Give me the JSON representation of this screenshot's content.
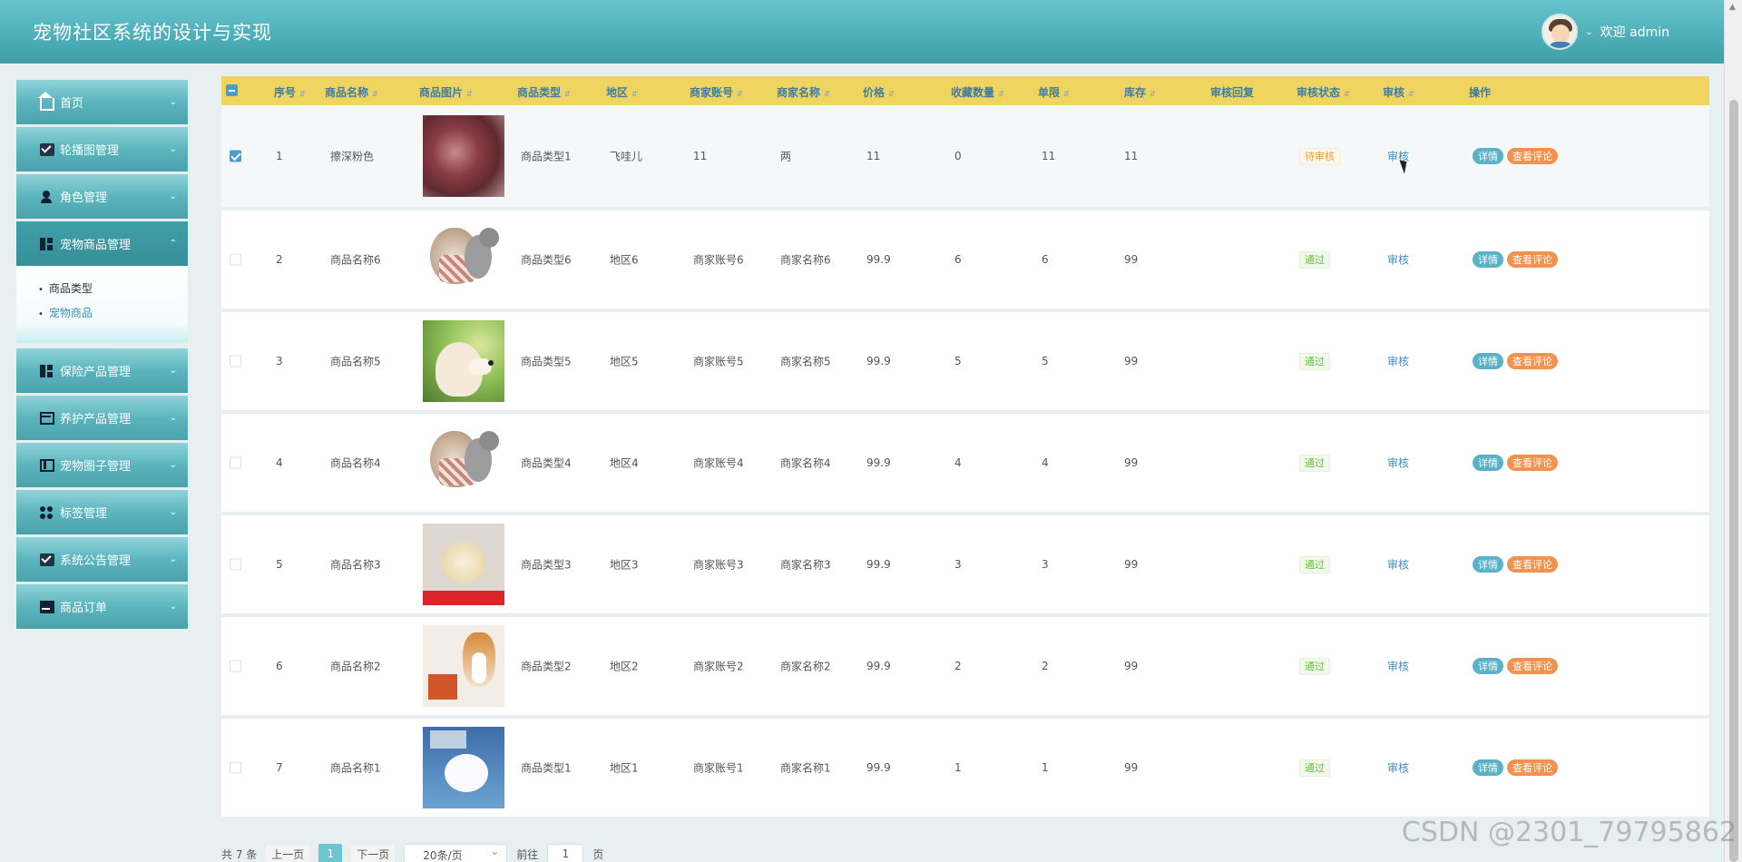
{
  "header": {
    "title": "宠物社区系统的设计与实现",
    "welcome": "欢迎 admin"
  },
  "sidebar": {
    "items": [
      {
        "label": "首页",
        "icon": "home-icon"
      },
      {
        "label": "轮播图管理",
        "icon": "mail-icon"
      },
      {
        "label": "角色管理",
        "icon": "user-icon"
      },
      {
        "label": "宠物商品管理",
        "icon": "grid-icon",
        "open": true,
        "children": [
          {
            "label": "商品类型"
          },
          {
            "label": "宠物商品",
            "active": true
          }
        ]
      },
      {
        "label": "保险产品管理",
        "icon": "grid-icon"
      },
      {
        "label": "养护产品管理",
        "icon": "layout-icon"
      },
      {
        "label": "宠物圈子管理",
        "icon": "panel-icon"
      },
      {
        "label": "标签管理",
        "icon": "dots-icon"
      },
      {
        "label": "系统公告管理",
        "icon": "mail-icon"
      },
      {
        "label": "商品订单",
        "icon": "card-icon"
      }
    ]
  },
  "table": {
    "columns": [
      "序号",
      "商品名称",
      "商品图片",
      "商品类型",
      "地区",
      "商家账号",
      "商家名称",
      "价格",
      "收藏数量",
      "单限",
      "库存",
      "审核回复",
      "审核状态",
      "审核",
      "操作"
    ],
    "audit_label": "审核",
    "detail_label": "详情",
    "review_label": "查看评论",
    "rows": [
      {
        "no": "1",
        "name": "擦深粉色",
        "type": "商品类型1",
        "region": "飞哇儿",
        "account": "11",
        "merchant": "两",
        "price": "11",
        "fav": "0",
        "limit": "11",
        "stock": "11",
        "reply": "",
        "status": "待审核",
        "checked": true,
        "img": "meat"
      },
      {
        "no": "2",
        "name": "商品名称6",
        "type": "商品类型6",
        "region": "地区6",
        "account": "商家账号6",
        "merchant": "商家名称6",
        "price": "99.9",
        "fav": "6",
        "limit": "6",
        "stock": "99",
        "reply": "",
        "status": "通过",
        "checked": false,
        "img": "hedgehog"
      },
      {
        "no": "3",
        "name": "商品名称5",
        "type": "商品类型5",
        "region": "地区5",
        "account": "商家账号5",
        "merchant": "商家名称5",
        "price": "99.9",
        "fav": "5",
        "limit": "5",
        "stock": "99",
        "reply": "",
        "status": "通过",
        "checked": false,
        "img": "dog"
      },
      {
        "no": "4",
        "name": "商品名称4",
        "type": "商品类型4",
        "region": "地区4",
        "account": "商家账号4",
        "merchant": "商家名称4",
        "price": "99.9",
        "fav": "4",
        "limit": "4",
        "stock": "99",
        "reply": "",
        "status": "通过",
        "checked": false,
        "img": "hedgehog"
      },
      {
        "no": "5",
        "name": "商品名称3",
        "type": "商品类型3",
        "region": "地区3",
        "account": "商家账号3",
        "merchant": "商家名称3",
        "price": "99.9",
        "fav": "3",
        "limit": "3",
        "stock": "99",
        "reply": "",
        "status": "通过",
        "checked": false,
        "img": "chick"
      },
      {
        "no": "6",
        "name": "商品名称2",
        "type": "商品类型2",
        "region": "地区2",
        "account": "商家账号2",
        "merchant": "商家名称2",
        "price": "99.9",
        "fav": "2",
        "limit": "2",
        "stock": "99",
        "reply": "",
        "status": "通过",
        "checked": false,
        "img": "corgi"
      },
      {
        "no": "7",
        "name": "商品名称1",
        "type": "商品类型1",
        "region": "地区1",
        "account": "商家账号1",
        "merchant": "商家名称1",
        "price": "99.9",
        "fav": "1",
        "limit": "1",
        "stock": "99",
        "reply": "",
        "status": "通过",
        "checked": false,
        "img": "hamster"
      }
    ]
  },
  "pager": {
    "total": "共 7 条",
    "prev": "上一页",
    "page": "1",
    "next": "下一页",
    "size": "20条/页",
    "goto": "前往",
    "goto_value": "1",
    "page_unit": "页"
  },
  "watermark": "CSDN @2301_79795862",
  "colors": {
    "header": "#4fb0b9",
    "table_header": "#efd45f",
    "detail_button": "#5ab2c8",
    "review_button": "#f1934f"
  }
}
